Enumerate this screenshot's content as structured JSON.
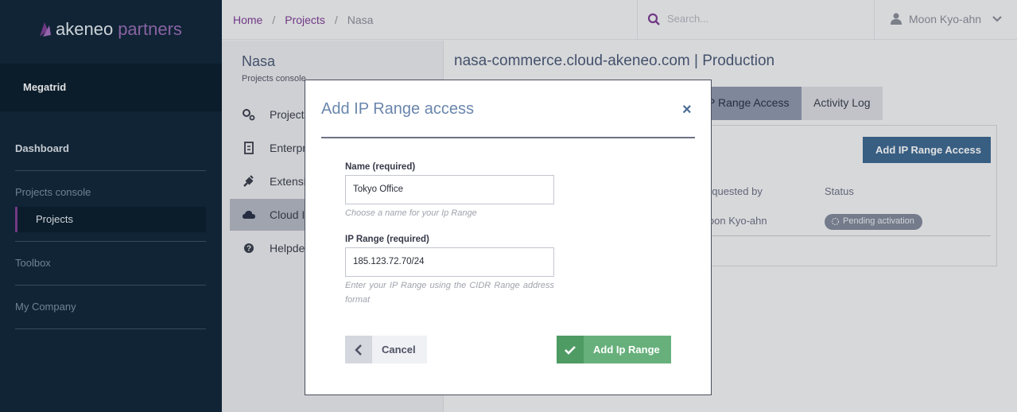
{
  "brand": {
    "name": "akeneo",
    "suffix": "partners"
  },
  "sidebar": {
    "organization": "Megatrid",
    "dashboard": "Dashboard",
    "section_projects_console": "Projects console",
    "projects": "Projects",
    "toolbox": "Toolbox",
    "my_company": "My Company"
  },
  "breadcrumb": {
    "home": "Home",
    "projects": "Projects",
    "current": "Nasa",
    "separator": "/"
  },
  "search": {
    "placeholder": "Search..."
  },
  "user": {
    "name": "Moon Kyo-ahn"
  },
  "project_nav": {
    "title": "Nasa",
    "subtitle": "Projects console",
    "items": [
      {
        "label": "Project",
        "icon": "gears-icon"
      },
      {
        "label": "Enterpr",
        "icon": "document-icon"
      },
      {
        "label": "Extensio",
        "icon": "plug-icon"
      },
      {
        "label": "Cloud I",
        "icon": "cloud-icon"
      },
      {
        "label": "Helpdes",
        "icon": "help-icon"
      }
    ]
  },
  "environment": {
    "title": "nasa-commerce.cloud-akeneo.com | Production",
    "tabs": [
      {
        "label": "IP Range Access",
        "visible": "P Range Access"
      },
      {
        "label": "Activity Log"
      }
    ],
    "add_button": "Add IP Range Access",
    "columns": {
      "requested_by": "equested by",
      "status": "Status"
    },
    "row": {
      "requested_by": "loon Kyo-ahn",
      "status": "Pending activation"
    }
  },
  "modal": {
    "title": "Add IP Range access",
    "close": "×",
    "name_label": "Name (required)",
    "name_value": "Tokyo Office",
    "name_hint": "Choose a name for your Ip Range",
    "range_label": "IP Range (required)",
    "range_value": "185.123.72.70/24",
    "range_hint": "Enter your IP Range using the CIDR Range address format",
    "cancel": "Cancel",
    "submit": "Add Ip Range"
  },
  "colors": {
    "sidebar": "#11263a",
    "accent_purple": "#7f3f95",
    "primary_blue": "#3f6991",
    "success_green": "#67b07b"
  }
}
